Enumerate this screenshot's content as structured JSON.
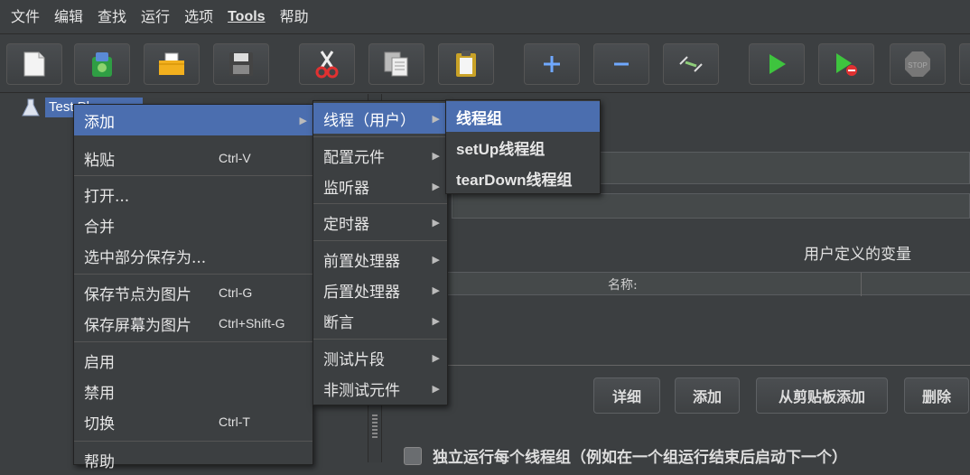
{
  "menubar": {
    "items": [
      "文件",
      "编辑",
      "查找",
      "运行",
      "选项",
      "Tools",
      "帮助"
    ]
  },
  "tree": {
    "root_label": "Test Plan"
  },
  "context_menu": {
    "items": [
      {
        "label": "添加",
        "shortcut": "",
        "submenu": true
      },
      {
        "label": "粘贴",
        "shortcut": "Ctrl-V"
      },
      {
        "label": "打开...",
        "shortcut": ""
      },
      {
        "label": "合并",
        "shortcut": ""
      },
      {
        "label": "选中部分保存为...",
        "shortcut": ""
      },
      {
        "label": "保存节点为图片",
        "shortcut": "Ctrl-G"
      },
      {
        "label": "保存屏幕为图片",
        "shortcut": "Ctrl+Shift-G"
      },
      {
        "label": "启用",
        "shortcut": ""
      },
      {
        "label": "禁用",
        "shortcut": ""
      },
      {
        "label": "切换",
        "shortcut": "Ctrl-T"
      },
      {
        "label": "帮助",
        "shortcut": ""
      }
    ]
  },
  "add_submenu": {
    "items": [
      "线程（用户）",
      "配置元件",
      "监听器",
      "定时器",
      "前置处理器",
      "后置处理器",
      "断言",
      "测试片段",
      "非测试元件"
    ]
  },
  "thread_submenu": {
    "items": [
      "线程组",
      "setUp线程组",
      "tearDown线程组"
    ]
  },
  "right_panel": {
    "udv_title": "用户定义的变量",
    "col_name": "名称:",
    "buttons": [
      "详细",
      "添加",
      "从剪贴板添加",
      "删除"
    ],
    "checkbox_label": "独立运行每个线程组（例如在一个组运行结束后启动下一个）"
  },
  "colors": {
    "selection": "#4b6eaf",
    "background": "#3c3f41"
  }
}
